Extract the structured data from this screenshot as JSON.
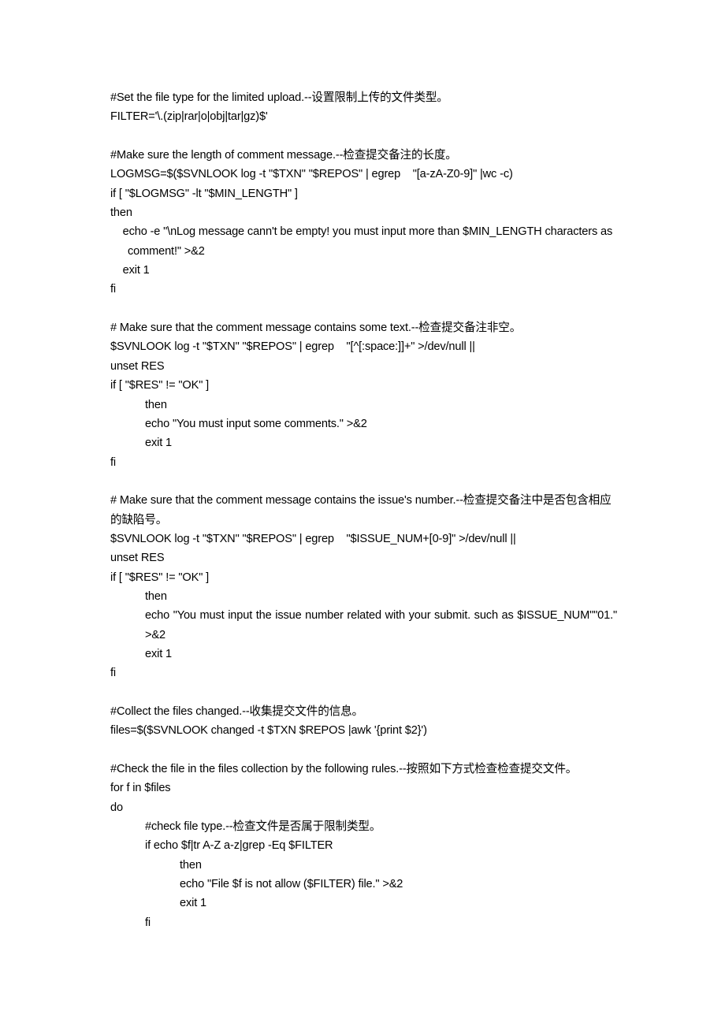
{
  "document": {
    "kind": "shell-script-listing",
    "language_note": "English comments with Chinese translations",
    "blocks": [
      {
        "id": "block-file-type",
        "lines": [
          {
            "text": "#Set the file type for the limited upload.--设置限制上传的文件类型。",
            "indent": 0
          },
          {
            "text": "FILTER='\\.(zip|rar|o|obj|tar|gz)$'",
            "indent": 0
          }
        ]
      },
      {
        "id": "block-spacer-1",
        "lines": [
          {
            "text": "",
            "indent": 0
          }
        ]
      },
      {
        "id": "block-comment-length",
        "lines": [
          {
            "text": "#Make sure the length of comment message.--检查提交备注的长度。",
            "indent": 0
          },
          {
            "text": "LOGMSG=$($SVNLOOK log -t \"$TXN\" \"$REPOS\" | egrep    \"[a-zA-Z0-9]\" |wc -c)",
            "indent": 0
          },
          {
            "text": "if [ \"$LOGMSG\" -lt \"$MIN_LENGTH\" ]",
            "indent": 0
          },
          {
            "text": "then",
            "indent": 0
          },
          {
            "text": "    echo -e \"\\nLog message cann't be empty! you must input more than $MIN_LENGTH characters as comment!\" >&2",
            "indent": 0,
            "hanging": 1
          },
          {
            "text": "    exit 1",
            "indent": 0
          },
          {
            "text": "fi",
            "indent": 0
          }
        ]
      },
      {
        "id": "block-spacer-2",
        "lines": [
          {
            "text": "",
            "indent": 0
          }
        ]
      },
      {
        "id": "block-comment-nonempty",
        "lines": [
          {
            "text": "# Make sure that the comment message contains some text.--检查提交备注非空。",
            "indent": 0
          },
          {
            "text": "$SVNLOOK log -t \"$TXN\" \"$REPOS\" | egrep    \"[^[:space:]]+\" >/dev/null ||",
            "indent": 0
          },
          {
            "text": "unset RES",
            "indent": 0
          },
          {
            "text": "if [ \"$RES\" != \"OK\" ]",
            "indent": 0
          },
          {
            "text": "then",
            "indent": 2
          },
          {
            "text": "echo \"You must input some comments.\" >&2",
            "indent": 2
          },
          {
            "text": "exit 1",
            "indent": 2
          },
          {
            "text": "fi",
            "indent": 0
          }
        ]
      },
      {
        "id": "block-spacer-3",
        "lines": [
          {
            "text": "",
            "indent": 0
          }
        ]
      },
      {
        "id": "block-issue-number",
        "lines": [
          {
            "text": "# Make sure that the comment message contains the issue's number.--检查提交备注中是否包含相应的缺陷号。",
            "indent": 0
          },
          {
            "text": "$SVNLOOK log -t \"$TXN\" \"$REPOS\" | egrep    \"$ISSUE_NUM+[0-9]\" >/dev/null ||",
            "indent": 0
          },
          {
            "text": "unset RES",
            "indent": 0
          },
          {
            "text": "if [ \"$RES\" != \"OK\" ]",
            "indent": 0
          },
          {
            "text": "then",
            "indent": 2
          },
          {
            "text": "echo \"You must input the issue number related with your submit. such as $ISSUE_NUM\"\"01.\" >&2",
            "indent": 2,
            "justified": true
          },
          {
            "text": "exit 1",
            "indent": 2
          },
          {
            "text": "fi",
            "indent": 0
          }
        ]
      },
      {
        "id": "block-spacer-4",
        "lines": [
          {
            "text": "",
            "indent": 0
          }
        ]
      },
      {
        "id": "block-collect-files",
        "lines": [
          {
            "text": "#Collect the files changed.--收集提交文件的信息。",
            "indent": 0
          },
          {
            "text": "files=$($SVNLOOK changed -t $TXN $REPOS |awk '{print $2}')",
            "indent": 0
          }
        ]
      },
      {
        "id": "block-spacer-5",
        "lines": [
          {
            "text": "",
            "indent": 0
          }
        ]
      },
      {
        "id": "block-check-rules",
        "lines": [
          {
            "text": "#Check the file in the files collection by the following rules.--按照如下方式检查检查提交文件。",
            "indent": 0
          },
          {
            "text": "for f in $files",
            "indent": 0
          },
          {
            "text": "do",
            "indent": 0
          },
          {
            "text": "#check file type.--检查文件是否属于限制类型。",
            "indent": 2
          },
          {
            "text": "if echo $f|tr A-Z a-z|grep -Eq $FILTER",
            "indent": 2
          },
          {
            "text": "then",
            "indent": 4
          },
          {
            "text": "echo \"File $f is not allow ($FILTER) file.\" >&2",
            "indent": 4
          },
          {
            "text": "exit 1",
            "indent": 4
          },
          {
            "text": "fi",
            "indent": 2
          }
        ]
      }
    ]
  }
}
